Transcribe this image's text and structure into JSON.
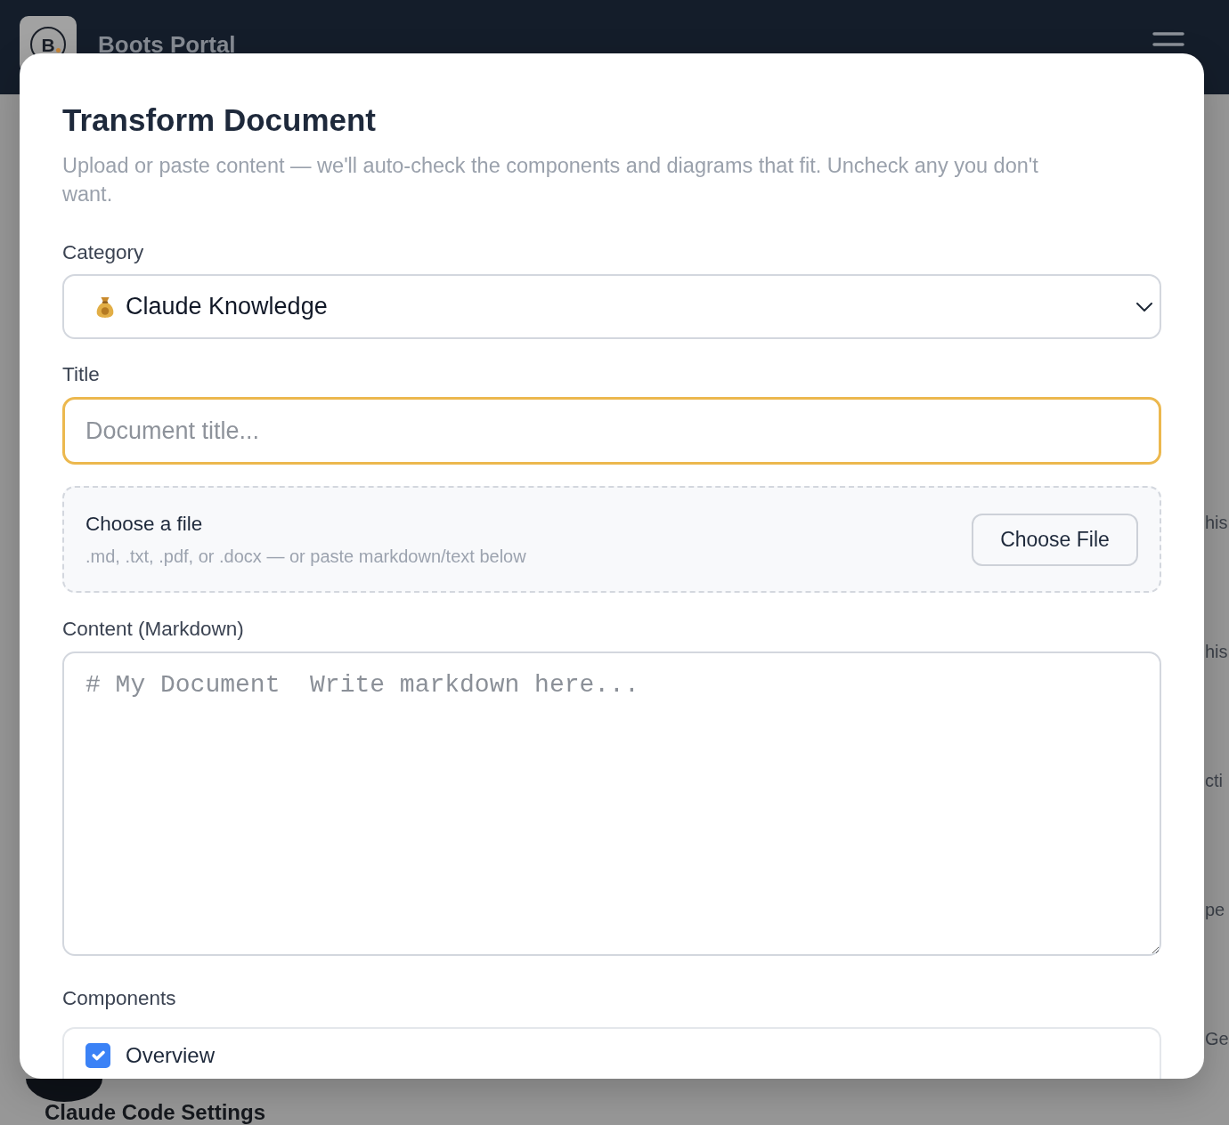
{
  "navbar": {
    "logo_letter": "B",
    "title": "Boots Portal"
  },
  "background": {
    "edge_fragments": [
      "his",
      "his",
      "cti",
      "pe",
      "Ge"
    ],
    "section_heading": "Claude Code Settings"
  },
  "modal": {
    "title": "Transform Document",
    "subtitle": "Upload or paste content — we'll auto-check the components and diagrams that fit. Uncheck any you don't want.",
    "fields": [
      {
        "kind": "select",
        "label": "Category",
        "value": "Claude Knowledge"
      },
      {
        "kind": "text",
        "label": "Title",
        "placeholder": "Document title...",
        "focused": true
      },
      {
        "kind": "file",
        "title": "Choose a file",
        "hint": ".md, .txt, .pdf, or .docx — or paste markdown/text below",
        "button": "Choose File"
      },
      {
        "kind": "textarea",
        "label": "Content (Markdown)",
        "placeholder": "# My Document  Write markdown here..."
      }
    ],
    "components": {
      "label": "Components",
      "items": [
        {
          "label": "Overview",
          "checked": true
        }
      ]
    }
  }
}
